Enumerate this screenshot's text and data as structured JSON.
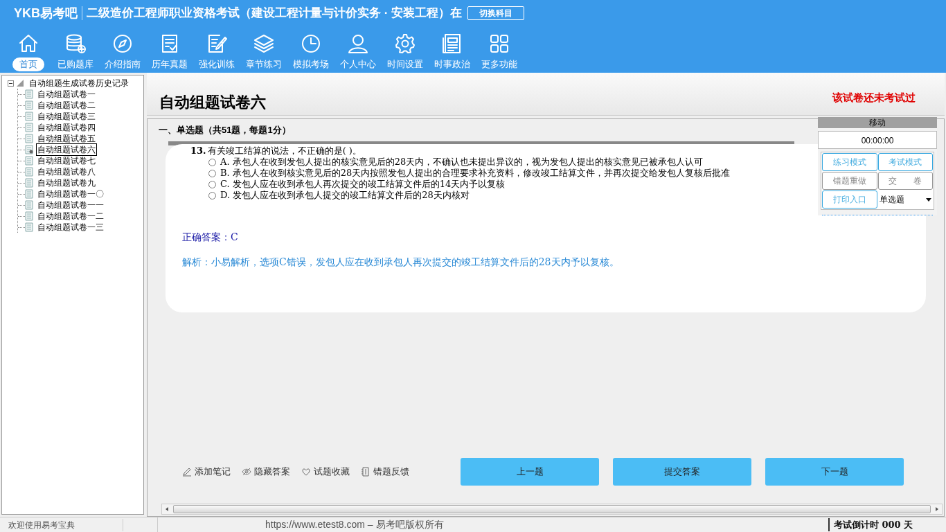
{
  "header": {
    "logo": "YKB易考吧",
    "exam_title": "二级造价工程师职业资格考试（建设工程计量与计价实务 · 安装工程）在",
    "switch_button": "切换科目"
  },
  "nav": [
    {
      "label": "首页",
      "selected": true
    },
    {
      "label": "已购题库",
      "selected": false
    },
    {
      "label": "介绍指南",
      "selected": false
    },
    {
      "label": "历年真题",
      "selected": false
    },
    {
      "label": "强化训练",
      "selected": false
    },
    {
      "label": "章节练习",
      "selected": false
    },
    {
      "label": "模拟考场",
      "selected": false
    },
    {
      "label": "个人中心",
      "selected": false
    },
    {
      "label": "时间设置",
      "selected": false
    },
    {
      "label": "时事政治",
      "selected": false
    },
    {
      "label": "更多功能",
      "selected": false
    }
  ],
  "tree": {
    "label": "自动组题生成试卷历史记录",
    "expanded": true,
    "children": [
      {
        "label": "自动组题试卷一",
        "selected": false
      },
      {
        "label": "自动组题试卷二",
        "selected": false
      },
      {
        "label": "自动组题试卷三",
        "selected": false
      },
      {
        "label": "自动组题试卷四",
        "selected": false
      },
      {
        "label": "自动组题试卷五",
        "selected": false
      },
      {
        "label": "自动组题试卷六",
        "selected": true
      },
      {
        "label": "自动组题试卷七",
        "selected": false
      },
      {
        "label": "自动组题试卷八",
        "selected": false
      },
      {
        "label": "自动组题试卷九",
        "selected": false
      },
      {
        "label": "自动组题试卷一〇",
        "selected": false
      },
      {
        "label": "自动组题试卷一一",
        "selected": false
      },
      {
        "label": "自动组题试卷一二",
        "selected": false
      },
      {
        "label": "自动组题试卷一三",
        "selected": false
      }
    ]
  },
  "paper": {
    "title": "自动组题试卷六",
    "status": "该试卷还未考试过"
  },
  "section": "一、单选题（共51题，每题1分）",
  "question": {
    "number": "13.",
    "text": "有关竣工结算的说法，不正确的是( )。",
    "options": [
      {
        "label": "A. 承包人在收到发包人提出的核实意见后的28天内，不确认也未提出异议的，视为发包人提出的核实意见已被承包人认可",
        "selected": false
      },
      {
        "label": "B. 承包人在收到核实意见后的28天内按照发包人提出的合理要求补充资料，修改竣工结算文件，并再次提交给发包人复核后批准",
        "selected": false
      },
      {
        "label": "C. 发包人应在收到承包人再次提交的竣工结算文件后的14天内予以复核",
        "selected": false
      },
      {
        "label": "D. 发包人应在收到承包人提交的竣工结算文件后的28天内核对",
        "selected": false
      }
    ],
    "answer": "正确答案：C",
    "analysis": "解析：小易解析，选项C错误，发包人应在收到承包人再次提交的竣工结算文件后的28天内予以复核。"
  },
  "panel": {
    "title": "移动",
    "timer": "00:00:00",
    "buttons": [
      {
        "label": "练习模式",
        "disabled": false
      },
      {
        "label": "考试模式",
        "disabled": false
      },
      {
        "label": "错题重做",
        "disabled": true
      },
      {
        "label": "交　　卷",
        "disabled": true
      },
      {
        "label": "打印入口",
        "disabled": false
      }
    ],
    "type_select": "单选题"
  },
  "tools": [
    "添加笔记",
    "隐藏答案",
    "试题收藏",
    "错题反馈"
  ],
  "actions": [
    "上一题",
    "提交答案",
    "下一题"
  ],
  "status_bar": {
    "welcome": "欢迎使用易考宝典",
    "copyright": "https://www.etest8.com – 易考吧版权所有",
    "countdown": "考试倒计时 000 天"
  }
}
